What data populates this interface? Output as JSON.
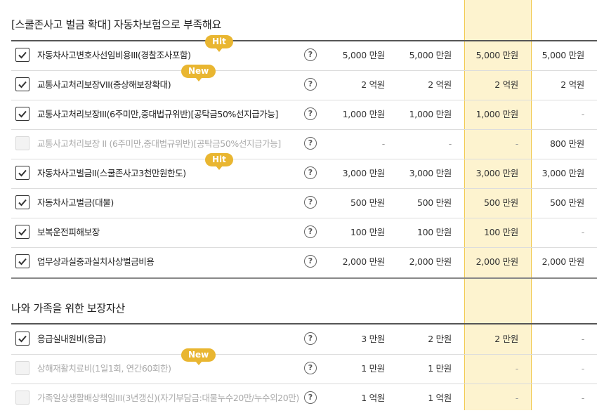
{
  "section1": {
    "title": "[스쿨존사고 벌금 확대] 자동차보험으로 부족해요",
    "rows": [
      {
        "label": "자동차사고변호사선임비용III(경찰조사포함)",
        "checked": true,
        "badge": "Hit",
        "values": [
          "5,000 만원",
          "5,000 만원",
          "5,000 만원",
          "5,000 만원"
        ]
      },
      {
        "label": "교통사고처리보장VII(중상해보장확대)",
        "checked": true,
        "badge": "New",
        "values": [
          "2 억원",
          "2 억원",
          "2 억원",
          "2 억원"
        ]
      },
      {
        "label": "교통사고처리보장III(6주미만,중대법규위반)[공탁금50%선지급가능]",
        "checked": true,
        "values": [
          "1,000 만원",
          "1,000 만원",
          "1,000 만원",
          "-"
        ]
      },
      {
        "label": "교통사고처리보장 II (6주미만,중대법규위반)[공탁금50%선지급가능]",
        "checked": false,
        "values": [
          "-",
          "-",
          "-",
          "800 만원"
        ]
      },
      {
        "label": "자동차사고벌금II(스쿨존사고3천만원한도)",
        "checked": true,
        "badge": "Hit",
        "values": [
          "3,000 만원",
          "3,000 만원",
          "3,000 만원",
          "3,000 만원"
        ]
      },
      {
        "label": "자동차사고벌금(대물)",
        "checked": true,
        "values": [
          "500 만원",
          "500 만원",
          "500 만원",
          "500 만원"
        ]
      },
      {
        "label": "보복운전피해보장",
        "checked": true,
        "values": [
          "100 만원",
          "100 만원",
          "100 만원",
          "-"
        ]
      },
      {
        "label": "업무상과실중과실치사상벌금비용",
        "checked": true,
        "values": [
          "2,000 만원",
          "2,000 만원",
          "2,000 만원",
          "2,000 만원"
        ]
      }
    ]
  },
  "section2": {
    "title": "나와 가족을 위한 보장자산",
    "rows": [
      {
        "label": "응급실내원비(응급)",
        "checked": true,
        "values": [
          "3 만원",
          "2 만원",
          "2 만원",
          "-"
        ]
      },
      {
        "label": "상해재활치료비(1일1회, 연간60회한)",
        "checked": false,
        "badge": "New",
        "values": [
          "1 만원",
          "1 만원",
          "-",
          "-"
        ]
      },
      {
        "label": "가족일상생활배상책임III(3년갱신)(자기부담금:대물누수20만/누수외20만)",
        "checked": false,
        "values": [
          "1 억원",
          "1 억원",
          "-",
          "-"
        ]
      }
    ]
  },
  "icons": {
    "checkbox": "check-icon",
    "help": "question-circle-icon"
  },
  "colors": {
    "highlight_column": "#fdf3cf",
    "highlight_border": "#f1c84b",
    "badge": "#e9b631"
  }
}
